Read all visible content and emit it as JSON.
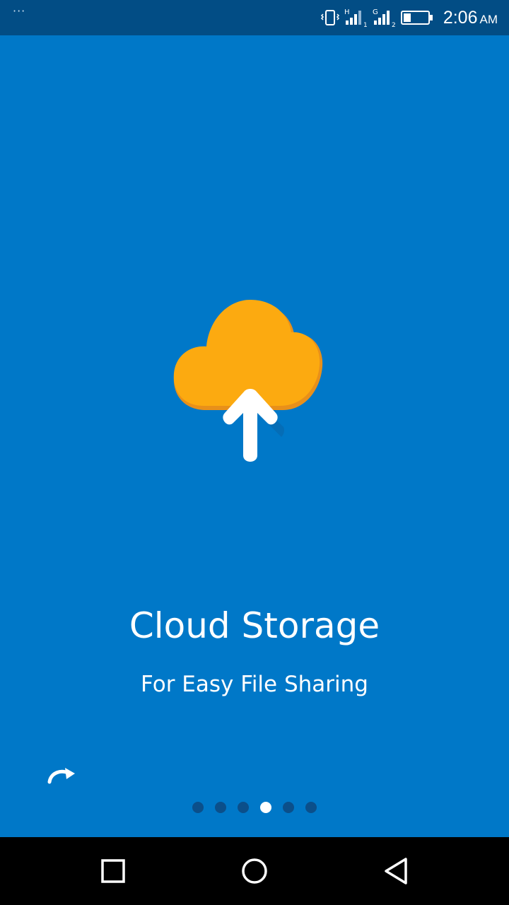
{
  "status_bar": {
    "overflow_icon": "overflow-dots-icon",
    "network_1_label": "H",
    "network_1_sim": "1",
    "network_2_label": "G",
    "network_2_sim": "2",
    "battery_level": 0.3,
    "time": "2:06",
    "ampm": "AM"
  },
  "onboarding": {
    "icon": "cloud-upload-icon",
    "title": "Cloud Storage",
    "subtitle": "For Easy File Sharing",
    "refresh_icon": "redo-arrow-icon",
    "page_count": 6,
    "active_page": 4
  },
  "nav_bar": {
    "recents_icon": "square-icon",
    "home_icon": "circle-icon",
    "back_icon": "triangle-back-icon"
  },
  "colors": {
    "background": "#0078c8",
    "status_bar": "#024d85",
    "cloud": "#fcaa10",
    "dot_inactive": "#0b4f8a",
    "dot_active": "#ffffff"
  }
}
